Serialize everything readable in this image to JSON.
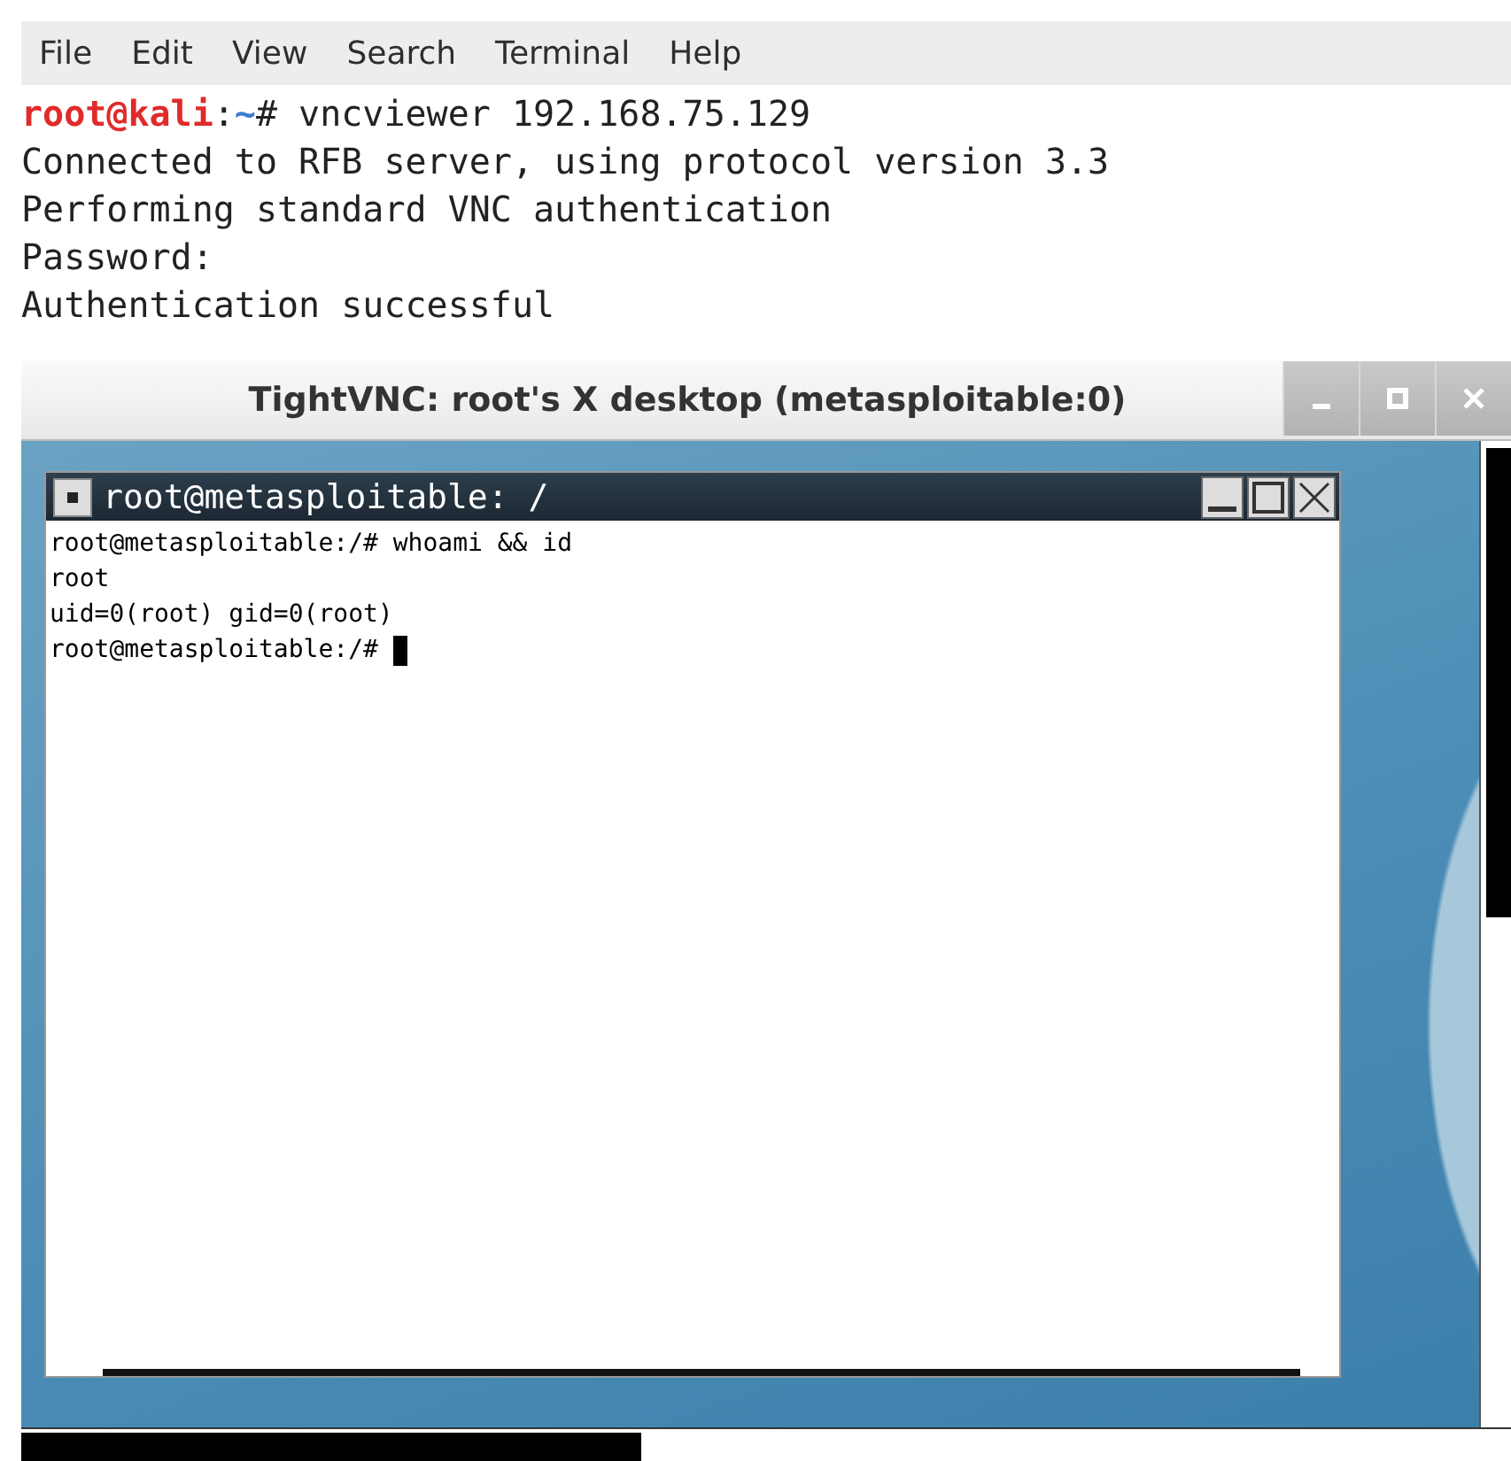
{
  "menu_bar": [
    "File",
    "Edit",
    "View",
    "Search",
    "Terminal",
    "Help"
  ],
  "terminal": {
    "prompt": {
      "user_host": "root@kali",
      "separator": ":",
      "path": "~",
      "command": "# vncviewer 192.168.75.129"
    },
    "output": [
      "Connected to RFB server, using protocol version 3.3",
      "Performing standard VNC authentication",
      "Password:",
      "Authentication successful"
    ]
  },
  "vnc_window": {
    "title": "TightVNC: root's X desktop (metasploitable:0)",
    "xterm": {
      "title": "root@metasploitable: /",
      "lines": [
        "root@metasploitable:/# whoami && id",
        "root",
        "uid=0(root) gid=0(root)",
        "root@metasploitable:/# "
      ]
    }
  }
}
